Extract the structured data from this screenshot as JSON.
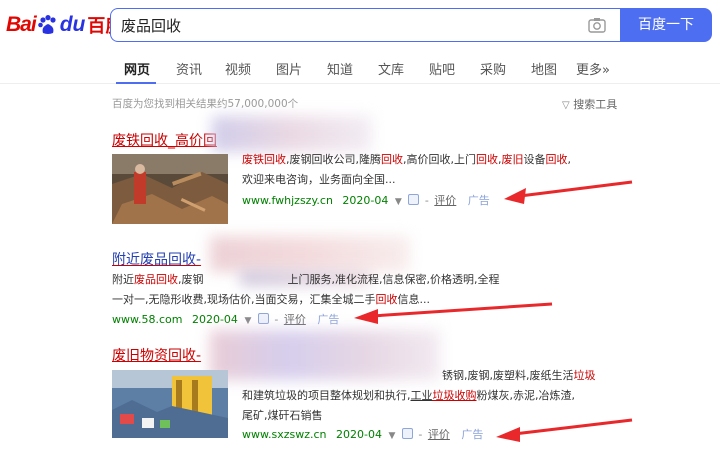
{
  "header": {
    "logo_bai": "Bai",
    "logo_du": "du",
    "logo_cn": "百度",
    "query": "废品回收",
    "search_button": "百度一下"
  },
  "tabs": [
    {
      "label": "网页",
      "active": true
    },
    {
      "label": "资讯"
    },
    {
      "label": "视频"
    },
    {
      "label": "图片"
    },
    {
      "label": "知道"
    },
    {
      "label": "文库"
    },
    {
      "label": "贴吧"
    },
    {
      "label": "采购"
    },
    {
      "label": "地图"
    },
    {
      "label": "更多»"
    }
  ],
  "stats": "百度为您找到相关结果约57,000,000个",
  "tools": "搜索工具",
  "results": [
    {
      "title_kw": "废铁回收",
      "title_rest": "_高价回",
      "desc": [
        {
          "t": "废铁回收",
          "kw": true
        },
        {
          "t": ",废钢回收公司,隆腾"
        },
        {
          "t": "回收",
          "kw": true
        },
        {
          "t": ",高价回收,上门"
        },
        {
          "t": "回收",
          "kw": true
        },
        {
          "t": ","
        },
        {
          "t": "废旧",
          "kw": true
        },
        {
          "t": "设备"
        },
        {
          "t": "回收",
          "kw": true
        },
        {
          "t": ","
        },
        {
          "t": "欢迎来电咨询，业务面向全国...",
          "br": true
        }
      ],
      "url": "www.fwhjzszy.cn",
      "date": "2020-04",
      "rate": "评价",
      "ad": "广告"
    },
    {
      "title_kw": "附近废品回收",
      "title_rest": "-",
      "desc": [
        {
          "t": "附近"
        },
        {
          "t": "废品回收",
          "kw": true
        },
        {
          "t": ",废钢"
        },
        {
          "t": "上门服务,准化流程,信息保密,价格透明,全程"
        },
        {
          "t": "一对一,无隐形收费,现场估价,当面交易，汇集全城二手",
          "br": true
        },
        {
          "t": "回收",
          "kw": true
        },
        {
          "t": "信息..."
        }
      ],
      "url": "www.58.com",
      "date": "2020-04",
      "rate": "评价",
      "ad": "广告"
    },
    {
      "title_kw": "废旧物资回收",
      "title_rest": "-",
      "desc_line1": "锈钢,废钢,废塑料,废纸生活",
      "desc_line1_kw": "垃圾",
      "desc_line2_a": "和建筑垃圾的项目整体规划和执行,",
      "desc_line2_b": "工业",
      "desc_line2_kw": "垃圾收购",
      "desc_line2_c": "粉煤灰,赤泥,冶炼渣,",
      "desc_line3": "尾矿,煤矸石销售",
      "url": "www.sxzswz.cn",
      "date": "2020-04",
      "rate": "评价",
      "ad": "广告"
    }
  ],
  "colors": {
    "accent": "#4e6ef2",
    "keyword": "#cc0000",
    "url": "#008000",
    "arrow": "#e8282b"
  }
}
